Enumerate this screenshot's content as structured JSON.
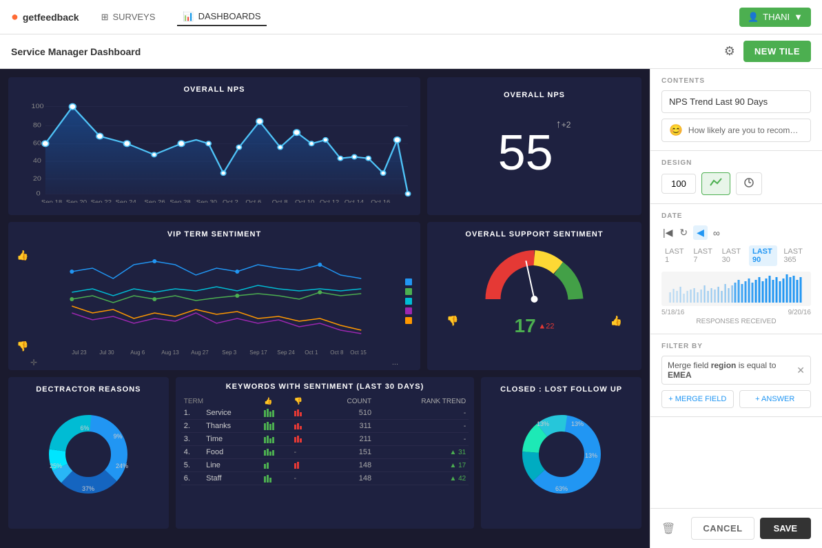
{
  "topnav": {
    "logo_text": "getfeedback",
    "surveys_label": "SURVEYS",
    "dashboards_label": "DASHBOARDS",
    "user_label": "THANI"
  },
  "subheader": {
    "title": "Service Manager Dashboard",
    "new_tile_label": "NEW TILE"
  },
  "dashboard": {
    "nps_chart_title": "OVERALL NPS",
    "nps_gauge_title": "OVERALL NPS",
    "nps_value": "55",
    "nps_change": "+2",
    "sentiment_chart_title": "VIP TERM SENTIMENT",
    "support_sentiment_title": "OVERALL SUPPORT SENTIMENT",
    "sentiment_value": "17",
    "sentiment_change": "+22",
    "detractor_title": "DECTRACTOR REASONS",
    "keywords_title": "KEYWORDS WITH SENTIMENT (LAST 30 DAYS)",
    "closed_title": "CLOSED : LOST FOLLOW UP",
    "keywords_headers": {
      "term": "TERM",
      "count": "COUNT",
      "rank_trend": "RANK TREND"
    },
    "keywords_rows": [
      {
        "num": "1.",
        "term": "Service",
        "count": "510",
        "trend": "-"
      },
      {
        "num": "2.",
        "term": "Thanks",
        "count": "311",
        "trend": "-"
      },
      {
        "num": "3.",
        "term": "Time",
        "count": "211",
        "trend": "-"
      },
      {
        "num": "4.",
        "term": "Food",
        "count": "151",
        "trend": "▲ 31"
      },
      {
        "num": "5.",
        "term": "Line",
        "count": "148",
        "trend": "▲ 17"
      },
      {
        "num": "6.",
        "term": "Staff",
        "count": "148",
        "trend": "▲ 42"
      }
    ],
    "detractor_segments": [
      {
        "pct": "6%",
        "color": "#29b6f6"
      },
      {
        "pct": "9%",
        "color": "#00e5ff"
      },
      {
        "pct": "24%",
        "color": "#00bcd4"
      },
      {
        "pct": "37%",
        "color": "#2196f3"
      },
      {
        "pct": "25%",
        "color": "#1565c0"
      }
    ],
    "closed_segments": [
      {
        "pct": "13%",
        "color": "#26c6da"
      },
      {
        "pct": "13%",
        "color": "#1de9b6"
      },
      {
        "pct": "13%",
        "color": "#00acc1"
      },
      {
        "pct": "63%",
        "color": "#2196f3"
      }
    ]
  },
  "right_panel": {
    "contents_label": "CONTENTS",
    "tile_name": "NPS Trend Last 90 Days",
    "survey_question": "How likely are you to recommend u...",
    "design_label": "DESIGN",
    "design_value": "100",
    "date_label": "DATE",
    "date_tabs": [
      "LAST 1",
      "LAST 7",
      "LAST 30",
      "LAST 90",
      "LAST 365"
    ],
    "active_date_tab": "LAST 90",
    "date_start": "5/18/16",
    "date_end": "9/20/16",
    "responses_label": "RESPONSES RECEIVED",
    "filter_label": "FILTER BY",
    "filter_field": "region",
    "filter_op": "is equal to",
    "filter_value": "EMEA",
    "merge_field_btn": "+ MERGE FIELD",
    "answer_btn": "+ ANSWER",
    "cancel_label": "CANCEL",
    "save_label": "SAVE"
  }
}
